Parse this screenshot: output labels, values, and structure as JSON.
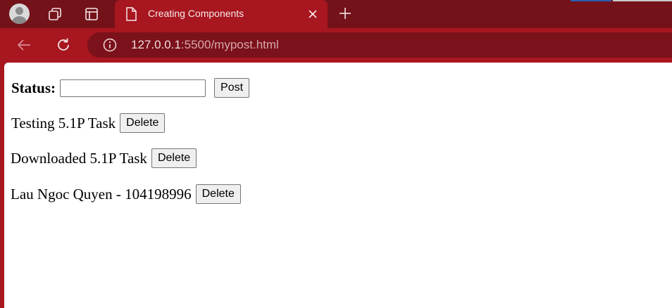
{
  "browser": {
    "tab_title": "Creating Components",
    "url_host": "127.0.0.1",
    "url_rest": ":5500/mypost.html"
  },
  "form": {
    "status_label": "Status:",
    "status_value": "",
    "post_button": "Post"
  },
  "posts": [
    {
      "text": "Testing 5.1P Task",
      "delete_label": "Delete"
    },
    {
      "text": "Downloaded 5.1P Task",
      "delete_label": "Delete"
    },
    {
      "text": "Lau Ngoc Quyen - 104198996",
      "delete_label": "Delete"
    }
  ],
  "colors": {
    "theme": "#a8161f",
    "tabstrip": "#74121a",
    "omnibox": "#7b111a"
  },
  "icons": [
    "profile-avatar-icon",
    "workspaces-icon",
    "tab-actions-icon",
    "page-icon",
    "close-icon",
    "new-tab-icon",
    "back-arrow-icon",
    "reload-icon",
    "site-info-icon"
  ]
}
